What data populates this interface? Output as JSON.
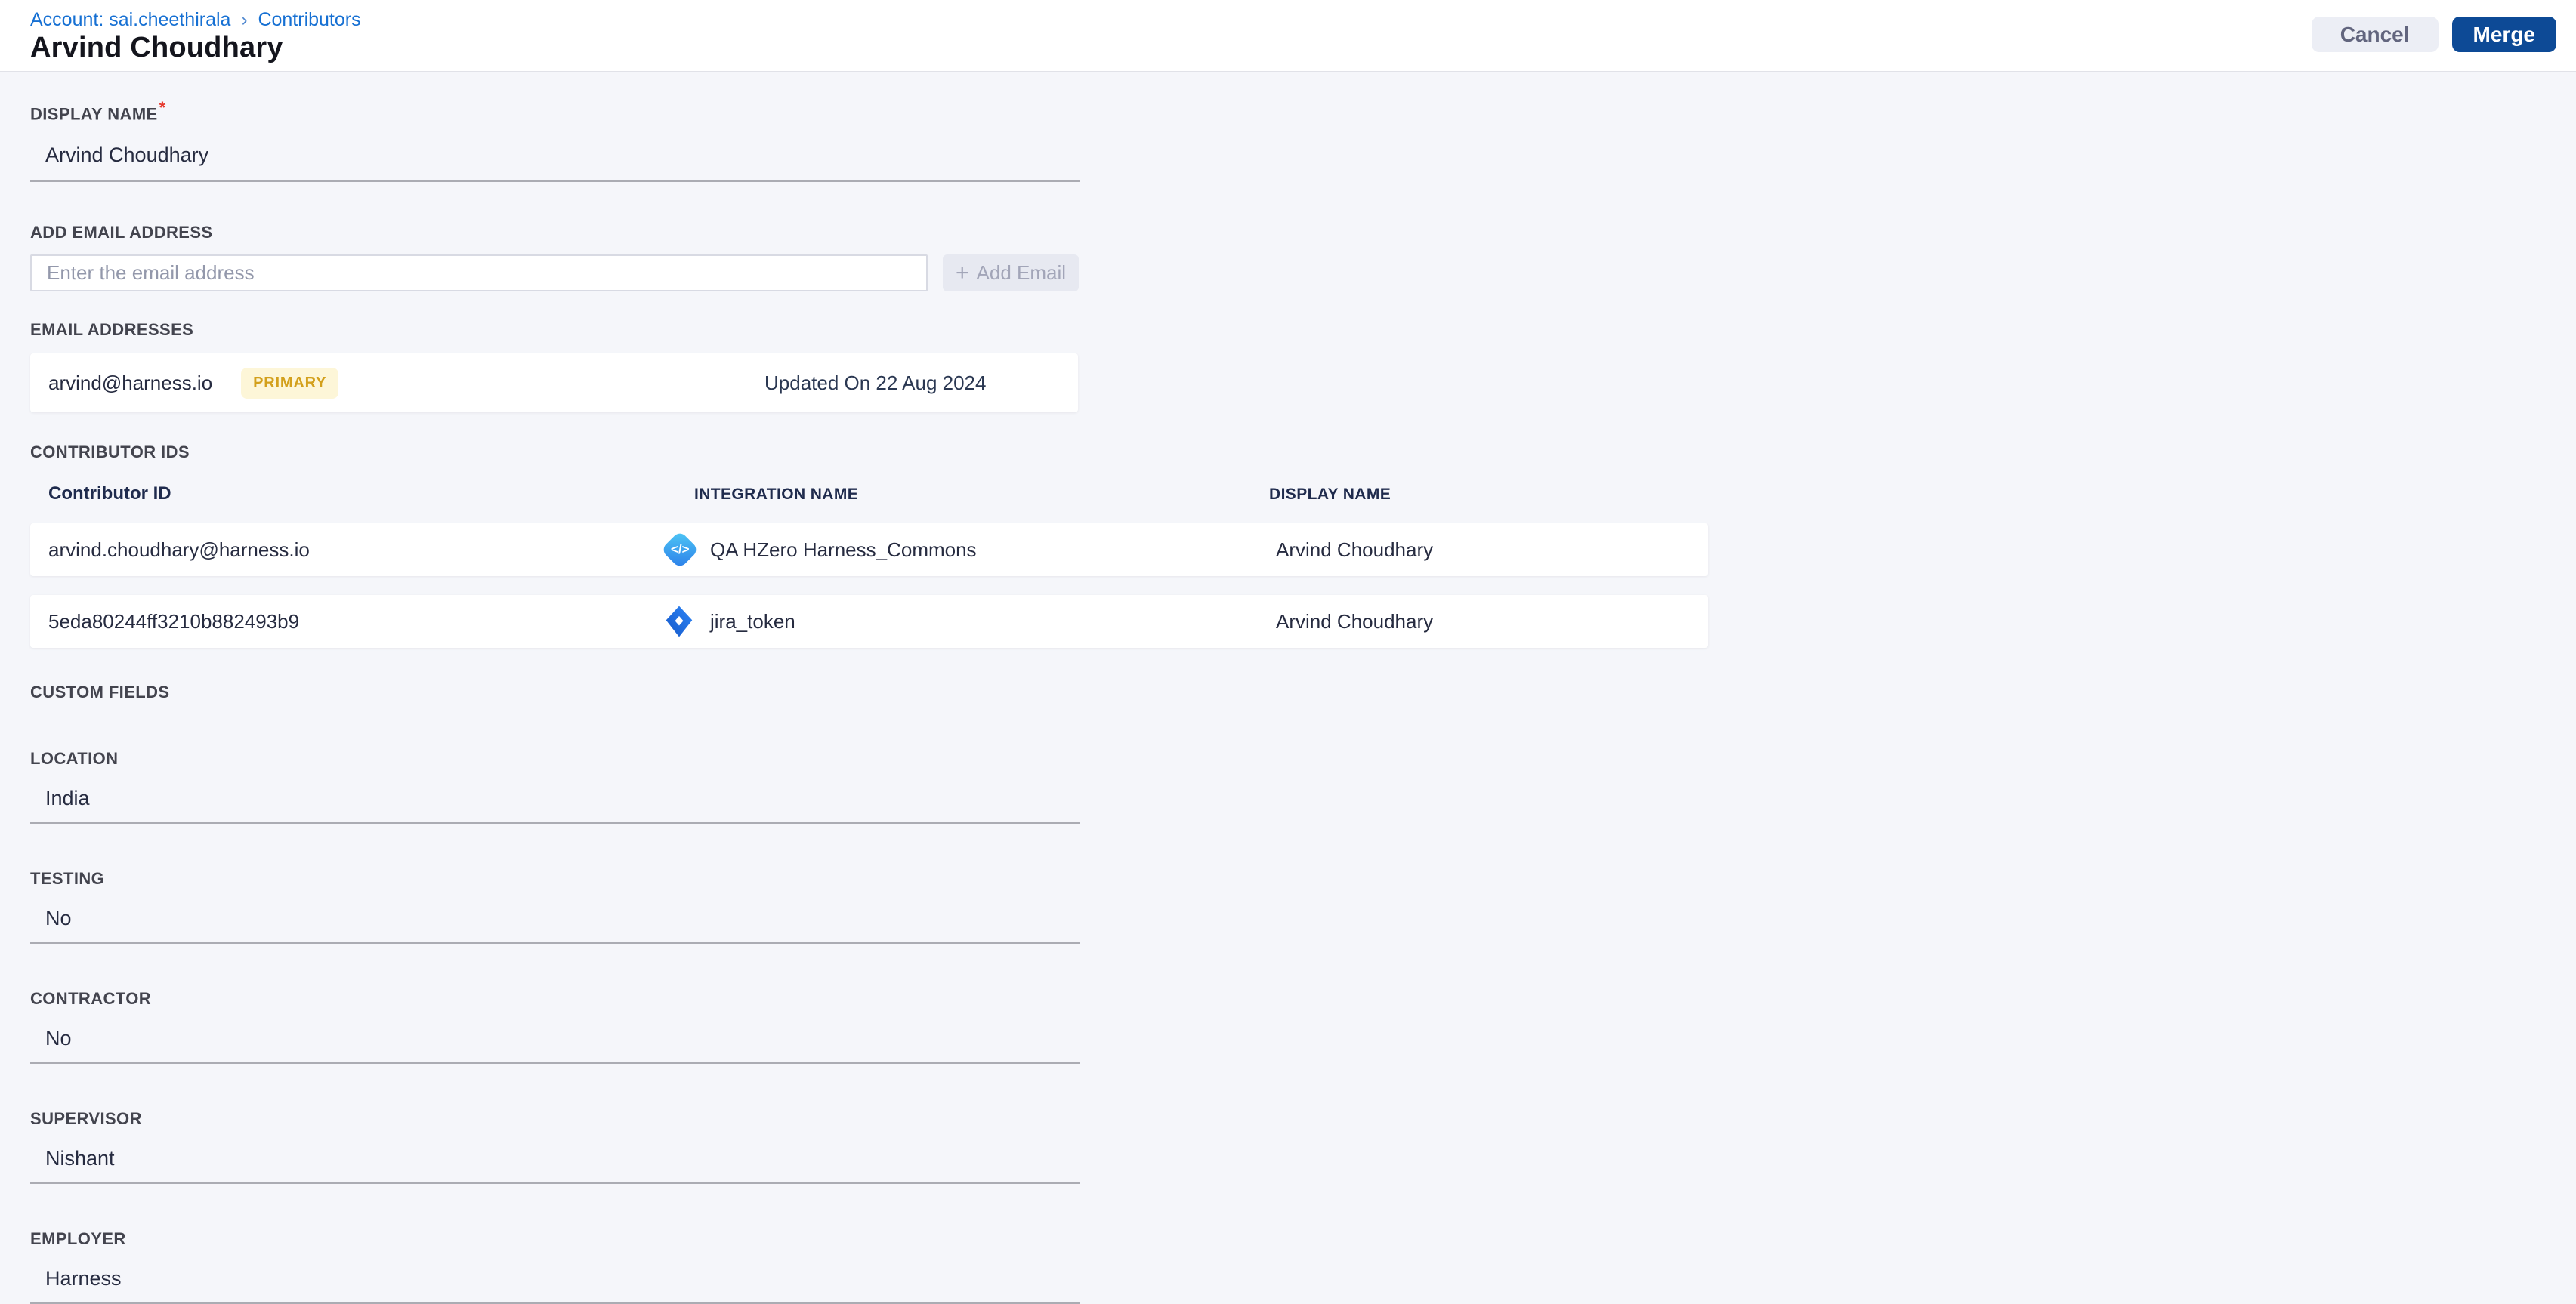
{
  "header": {
    "breadcrumb": {
      "account": "Account: sai.cheethirala",
      "separator": "›",
      "section": "Contributors"
    },
    "title": "Arvind Choudhary",
    "actions": {
      "cancel": "Cancel",
      "merge": "Merge"
    }
  },
  "form": {
    "display_name": {
      "label": "DISPLAY NAME",
      "required_mark": "*",
      "value": "Arvind Choudhary"
    },
    "add_email": {
      "label": "ADD EMAIL ADDRESS",
      "placeholder": "Enter the email address",
      "button_icon": "+",
      "button_label": "Add Email"
    },
    "email_addresses": {
      "label": "EMAIL ADDRESSES",
      "items": [
        {
          "email": "arvind@harness.io",
          "badge": "PRIMARY",
          "updated": "Updated On 22 Aug 2024"
        }
      ]
    },
    "contributor_ids": {
      "label": "CONTRIBUTOR IDS",
      "columns": {
        "id": "Contributor ID",
        "integration": "INTEGRATION NAME",
        "display": "DISPLAY NAME"
      },
      "rows": [
        {
          "id": "arvind.choudhary@harness.io",
          "integration_icon": "code-integration-icon",
          "integration": "QA HZero Harness_Commons",
          "display": "Arvind Choudhary"
        },
        {
          "id": "5eda80244ff3210b882493b9",
          "integration_icon": "jira-icon",
          "integration": "jira_token",
          "display": "Arvind Choudhary"
        }
      ]
    },
    "custom_fields": {
      "label": "CUSTOM FIELDS",
      "fields": [
        {
          "label": "LOCATION",
          "value": "India"
        },
        {
          "label": "TESTING",
          "value": "No"
        },
        {
          "label": "CONTRACTOR",
          "value": "No"
        },
        {
          "label": "SUPERVISOR",
          "value": "Nishant"
        },
        {
          "label": "EMPLOYER",
          "value": "Harness"
        }
      ]
    }
  },
  "icons": {
    "code_glyph": "</>"
  },
  "colors": {
    "primary_button": "#0d4a96",
    "breadcrumb_link": "#1670d3",
    "badge_bg": "#fdf6d8",
    "badge_text": "#d3a01c",
    "background": "#f5f6fa",
    "required_mark": "#e6392e"
  }
}
